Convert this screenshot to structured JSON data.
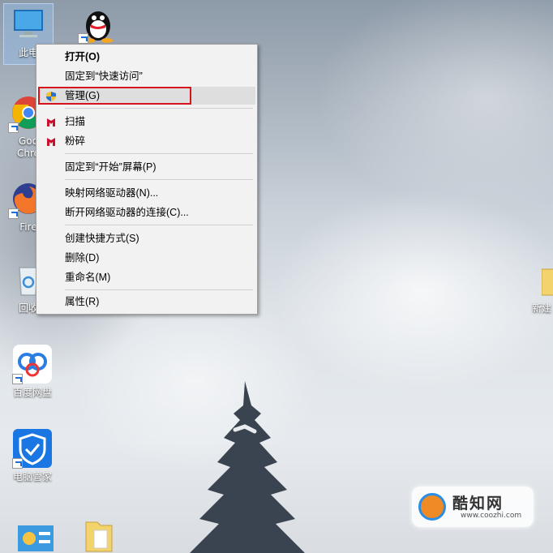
{
  "desktop": {
    "icons": [
      {
        "label": "此电"
      },
      {
        "label": ""
      },
      {
        "label": "Goo"
      },
      {
        "label": "Chro"
      },
      {
        "label": "Fire"
      },
      {
        "label": "回收"
      },
      {
        "label": "百度网盘"
      },
      {
        "label": "电脑管家"
      },
      {
        "label": "新建"
      }
    ]
  },
  "context_menu": {
    "items": [
      {
        "label": "打开(O)"
      },
      {
        "label": "固定到“快速访问”"
      },
      {
        "label": "管理(G)"
      },
      {
        "label": "扫描"
      },
      {
        "label": "粉碎"
      },
      {
        "label": "固定到“开始”屏幕(P)"
      },
      {
        "label": "映射网络驱动器(N)..."
      },
      {
        "label": "断开网络驱动器的连接(C)..."
      },
      {
        "label": "创建快捷方式(S)"
      },
      {
        "label": "删除(D)"
      },
      {
        "label": "重命名(M)"
      },
      {
        "label": "属性(R)"
      }
    ],
    "highlight_color": "#d4141a",
    "highlighted_item": "管理(G)"
  },
  "watermark": {
    "title": "酷知网",
    "subtitle": "www.coozhi.com"
  },
  "icons": [
    "computer-icon",
    "qq-icon",
    "chrome-icon",
    "firefox-icon",
    "recycle-bin-icon",
    "baidu-netdisk-icon",
    "pc-manager-icon",
    "folder-icon",
    "shield-icon",
    "mcafee-icon"
  ]
}
